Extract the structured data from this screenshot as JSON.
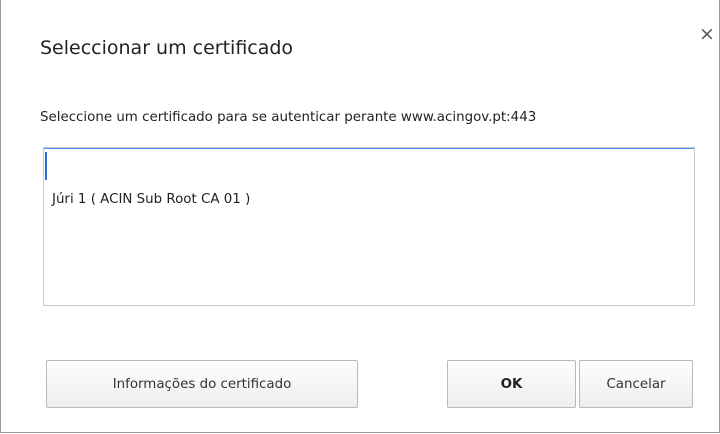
{
  "dialog": {
    "title": "Seleccionar um certificado",
    "close_glyph": "×",
    "prompt": "Seleccione um certificado para se autenticar perante www.acingov.pt:443"
  },
  "certificates": [
    {
      "label": "Júri 1 ( ACIN Sub Root CA 01 )"
    }
  ],
  "buttons": {
    "info_label": "Informações do certificado",
    "ok_label": "OK",
    "cancel_label": "Cancelar"
  },
  "colors": {
    "focus_border": "#4d90fe",
    "caret": "#2a6cd6"
  },
  "icons": {
    "close": "close-icon"
  }
}
